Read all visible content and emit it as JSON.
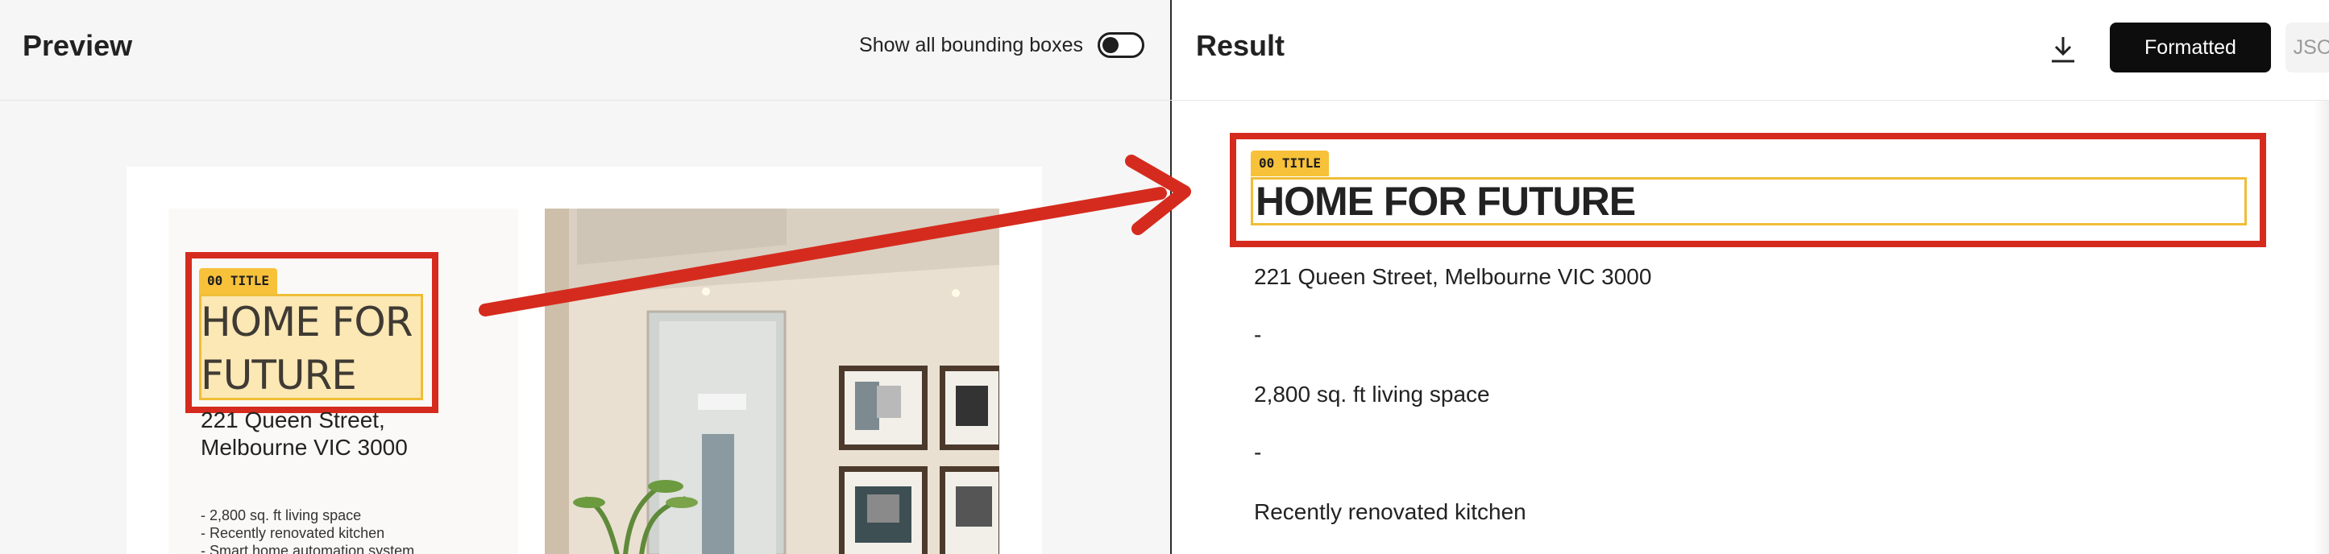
{
  "preview": {
    "title": "Preview",
    "toggle_label": "Show all bounding boxes",
    "toggle_on": false,
    "document": {
      "chip": "00 TITLE",
      "title": "HOME FOR FUTURE",
      "address": "221 Queen Street, Melbourne VIC 3000",
      "bullets": [
        "- 2,800 sq. ft living space",
        "- Recently renovated kitchen",
        "- Smart home automation system"
      ]
    }
  },
  "result": {
    "title": "Result",
    "download_icon": "download-icon",
    "formatted_label": "Formatted",
    "json_label": "JSON",
    "chip": "00 TITLE",
    "heading": "HOME FOR FUTURE",
    "lines": [
      "221 Queen Street, Melbourne VIC 3000",
      "-",
      "2,800 sq. ft living space",
      "-",
      "Recently renovated kitchen"
    ]
  },
  "colors": {
    "highlight": "#f7c13a",
    "annotation_red": "#d52b1e",
    "button_dark": "#0d0d0d"
  }
}
